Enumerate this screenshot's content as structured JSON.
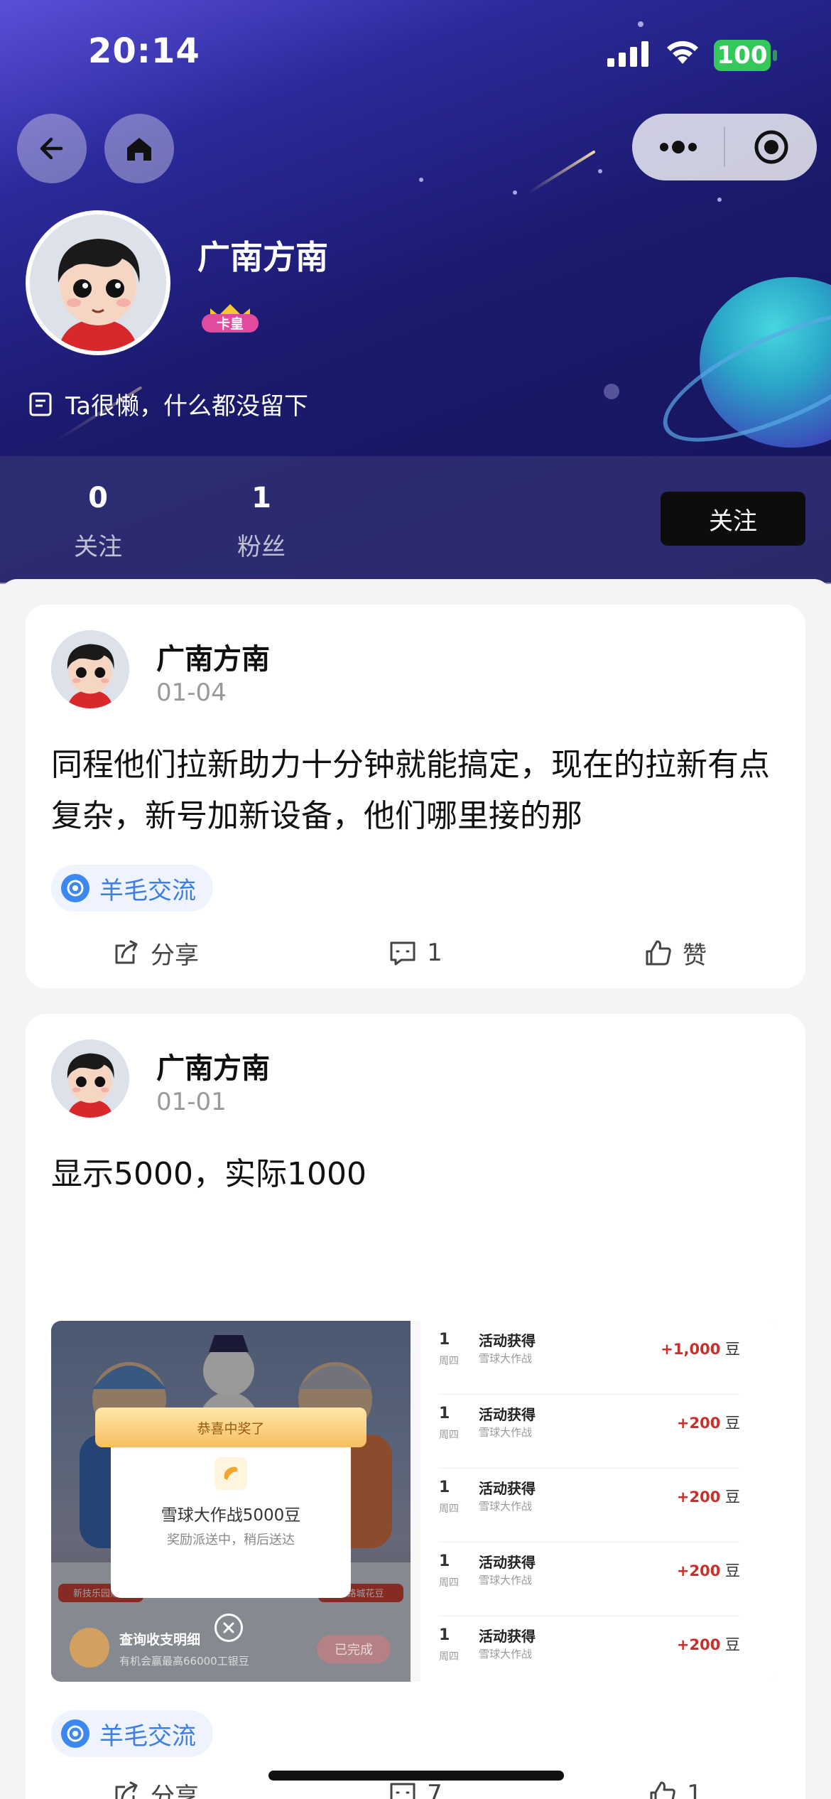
{
  "status_bar": {
    "time": "20:14",
    "battery": "100"
  },
  "colors": {
    "follow_button": "#0d0d0d",
    "tag_blue": "#3d7ee6",
    "amount_red": "#c8302a",
    "battery_green": "#34c759"
  },
  "profile": {
    "username": "广南方南",
    "badge": "卡皇",
    "bio": "Ta很懒，什么都没留下",
    "following_count": "0",
    "following_label": "关注",
    "followers_count": "1",
    "followers_label": "粉丝",
    "follow_button": "关注"
  },
  "posts": [
    {
      "author": "广南方南",
      "date": "01-04",
      "text": "同程他们拉新助力十分钟就能搞定，现在的拉新有点复杂，新号加新设备，他们哪里接的那",
      "tag": "羊毛交流",
      "share_label": "分享",
      "comment_count": "1",
      "like_label": "赞"
    },
    {
      "author": "广南方南",
      "date": "01-01",
      "text": "显示5000，实际1000",
      "tag": "羊毛交流",
      "share_label": "分享",
      "comment_count": "7",
      "like_label": "1",
      "image": {
        "popup_ribbon": "恭喜中奖了",
        "popup_title": "雪球大作战5000豆",
        "popup_subtitle": "奖励派送中，稍后送达",
        "left_banner": "新技乐园赚豆",
        "right_banner": "铁路城花豆",
        "bottom_title": "查询收支明细",
        "bottom_subtitle": "有机会赢最高66000工银豆",
        "bottom_button": "已完成",
        "transactions": [
          {
            "day": "1",
            "weekday": "周四",
            "title": "活动获得",
            "source": "雪球大作战",
            "amount": "+1,000",
            "unit": "豆"
          },
          {
            "day": "1",
            "weekday": "周四",
            "title": "活动获得",
            "source": "雪球大作战",
            "amount": "+200",
            "unit": "豆"
          },
          {
            "day": "1",
            "weekday": "周四",
            "title": "活动获得",
            "source": "雪球大作战",
            "amount": "+200",
            "unit": "豆"
          },
          {
            "day": "1",
            "weekday": "周四",
            "title": "活动获得",
            "source": "雪球大作战",
            "amount": "+200",
            "unit": "豆"
          },
          {
            "day": "1",
            "weekday": "周四",
            "title": "活动获得",
            "source": "雪球大作战",
            "amount": "+200",
            "unit": "豆"
          }
        ]
      }
    }
  ]
}
